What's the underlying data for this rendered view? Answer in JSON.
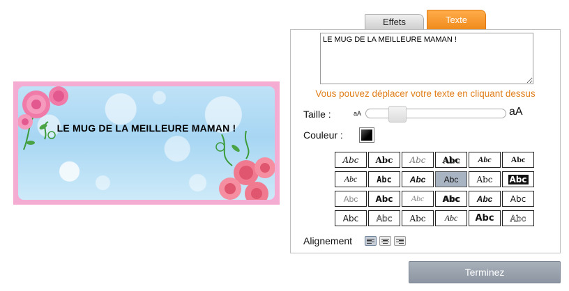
{
  "preview": {
    "mug_text": "LE MUG DE LA MEILLEURE MAMAN !",
    "border_color": "#f4acd3",
    "background_color": "#a7d6f3"
  },
  "tabs": [
    {
      "label": "Effets",
      "active": false
    },
    {
      "label": "Texte",
      "active": true
    }
  ],
  "text_panel": {
    "text_value": "LE MUG DE LA MEILLEURE MAMAN !",
    "hint": "Vous pouvez déplacer votre texte en cliquant dessus",
    "hint_color": "#e07f1a",
    "size_label": "Taille :",
    "size_small": "aA",
    "size_big": "aA",
    "size_slider_level": 0.18,
    "color_label": "Couleur :",
    "text_color": "#000000",
    "font_samples": [
      "Abc",
      "Abc",
      "Abc",
      "Abc",
      "Abc",
      "Abc",
      "Abc",
      "Abc",
      "Abc",
      "Abc",
      "Abc",
      "Abc",
      "Abc",
      "Abc",
      "Abc",
      "Abc",
      "Abc",
      "Abc",
      "Abc",
      "Abc",
      "Abc",
      "Abc",
      "Abc",
      "Abc"
    ],
    "selected_font_index": 9,
    "alignment_label": "Alignement",
    "alignment_options": [
      "align-left-icon",
      "align-center-icon",
      "align-right-icon"
    ],
    "alignment_active": 0
  },
  "finish_button": {
    "label": "Terminez"
  },
  "accent_color": "#f08b1c"
}
